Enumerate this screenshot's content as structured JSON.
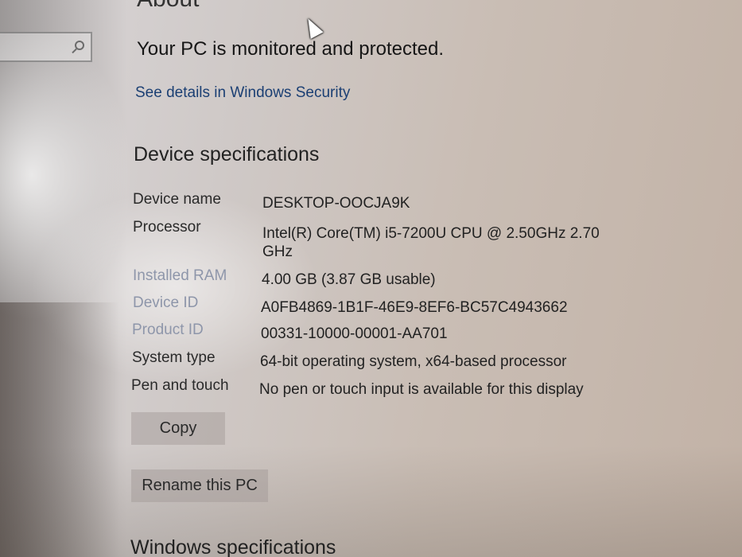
{
  "page": {
    "title": "About",
    "status": "Your PC is monitored and protected.",
    "security_link": "See details in Windows Security"
  },
  "device_specs": {
    "heading": "Device specifications",
    "items": [
      {
        "label": "Device name",
        "value": "DESKTOP-OOCJA9K"
      },
      {
        "label": "Processor",
        "value": "Intel(R) Core(TM) i5-7200U CPU @ 2.50GHz   2.70 GHz"
      },
      {
        "label": "Installed RAM",
        "value": "4.00 GB (3.87 GB usable)"
      },
      {
        "label": "Device ID",
        "value": "A0FB4869-1B1F-46E9-8EF6-BC57C4943662"
      },
      {
        "label": "Product ID",
        "value": "00331-10000-00001-AA701"
      },
      {
        "label": "System type",
        "value": "64-bit operating system, x64-based processor"
      },
      {
        "label": "Pen and touch",
        "value": "No pen or touch input is available for this display"
      }
    ],
    "copy_label": "Copy",
    "rename_label": "Rename this PC"
  },
  "windows_specs": {
    "heading": "Windows specifications"
  },
  "icons": {
    "search": "search-icon",
    "cursor": "mouse-pointer-icon"
  }
}
